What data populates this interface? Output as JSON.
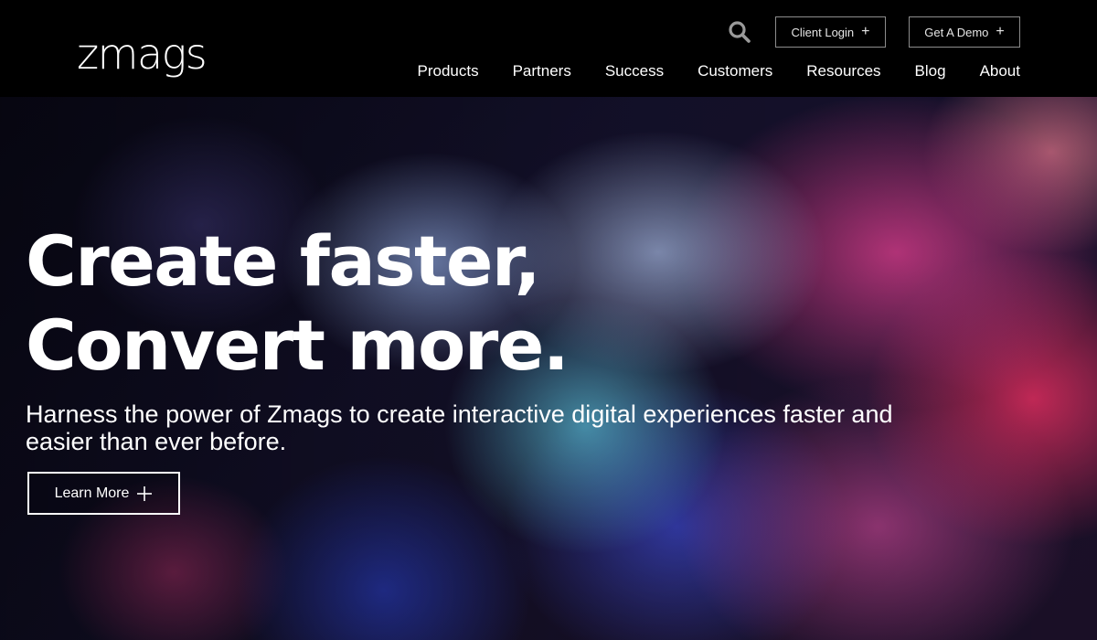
{
  "header": {
    "logo": "zmags",
    "search_icon": "search-icon",
    "client_login": "Client Login",
    "get_demo": "Get A Demo",
    "plus": "+",
    "nav": [
      {
        "label": "Products"
      },
      {
        "label": "Partners"
      },
      {
        "label": "Success"
      },
      {
        "label": "Customers"
      },
      {
        "label": "Resources"
      },
      {
        "label": "Blog"
      },
      {
        "label": "About"
      }
    ]
  },
  "hero": {
    "headline_line1": "Create faster,",
    "headline_line2": "Convert more.",
    "subtext": "Harness the power of Zmags to create interactive digital experiences faster and easier than ever before.",
    "cta": "Learn More",
    "cta_icon": "plus-icon"
  },
  "colors": {
    "header_bg": "#000000",
    "text": "#ffffff",
    "button_border": "#8c8c8c"
  }
}
